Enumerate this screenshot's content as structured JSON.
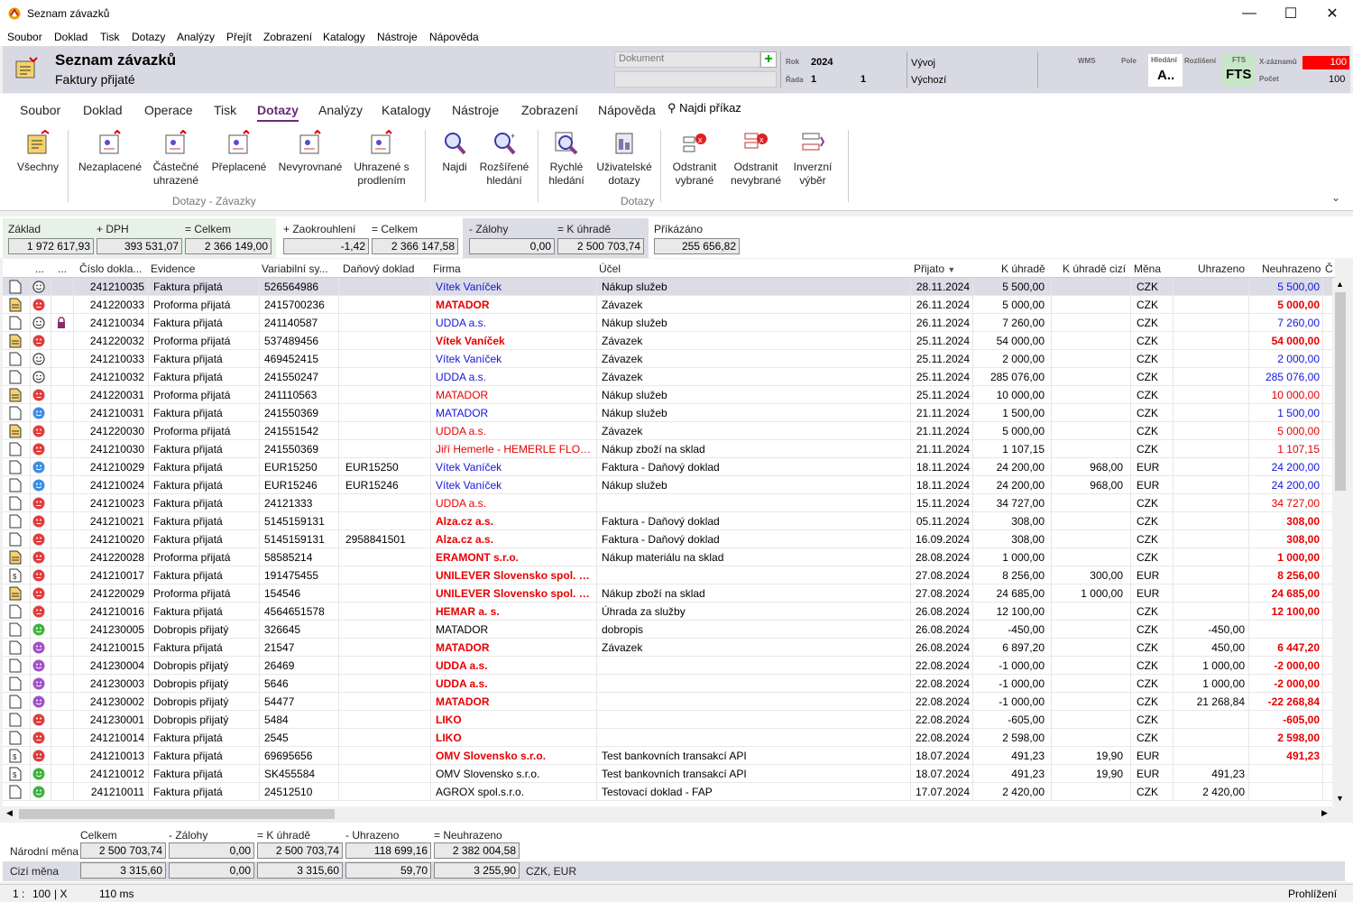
{
  "window": {
    "title": "Seznam závazků"
  },
  "menu": [
    "Soubor",
    "Doklad",
    "Tisk",
    "Dotazy",
    "Analýzy",
    "Přejít",
    "Zobrazení",
    "Katalogy",
    "Nástroje",
    "Nápověda"
  ],
  "header": {
    "title": "Seznam závazků",
    "subtitle": "Faktury přijaté",
    "doc_placeholder": "Dokument",
    "rok_label": "Rok",
    "rok": "2024",
    "rada_label": "Řada",
    "rada1": "1",
    "rada2": "1",
    "vyvoj": "Vývoj",
    "vychozi": "Výchozí",
    "wms": "WMS",
    "pole": "Pole",
    "hledani": "Hledání",
    "hledani_val": "A..",
    "rozliseni": "Rozlišení",
    "fts_label": "FTS",
    "fts": "FTS",
    "xzaz_label": "X-záznamů",
    "xzaz": "100",
    "pocet_label": "Počet",
    "pocet": "100"
  },
  "tabs": [
    "Soubor",
    "Doklad",
    "Operace",
    "Tisk",
    "Dotazy",
    "Analýzy",
    "Katalogy",
    "Nástroje",
    "Zobrazení",
    "Nápověda"
  ],
  "find_cmd": "Najdi příkaz",
  "ribbon": {
    "vsechny": "Všechny",
    "nezaplacene": "Nezaplacené",
    "castecne": [
      "Částečné",
      "uhrazené"
    ],
    "preplacene": "Přeplacené",
    "nevyrovnane": "Nevyrovnané",
    "uhrazene_s": [
      "Uhrazené s",
      "prodlením"
    ],
    "najdi": "Najdi",
    "rozsirene": [
      "Rozšířené",
      "hledání"
    ],
    "rychle": [
      "Rychlé",
      "hledání"
    ],
    "uzivatelske": [
      "Uživatelské",
      "dotazy"
    ],
    "odstranit_vybrane": [
      "Odstranit",
      "vybrané"
    ],
    "odstranit_nevybrane": [
      "Odstranit",
      "nevybrané"
    ],
    "inverzni": [
      "Inverzní",
      "výběr"
    ],
    "group1": "Dotazy - Závazky",
    "group2": "Dotazy"
  },
  "sums": {
    "zaklad_l": "Základ",
    "zaklad": "1 972 617,93",
    "dph_l": "+ DPH",
    "dph": "393 531,07",
    "celkem_l": "= Celkem",
    "celkem": "2 366 149,00",
    "zaokr_l": "+ Zaokrouhlení",
    "zaokr": "-1,42",
    "celkem2_l": "= Celkem",
    "celkem2": "2 366 147,58",
    "zalohy_l": "- Zálohy",
    "zalohy": "0,00",
    "kuhrade_l": "= K úhradě",
    "kuhrade": "2 500 703,74",
    "prikaz_l": "Příkázáno",
    "prikaz": "255 656,82"
  },
  "columns": [
    "...",
    "...",
    "Číslo dokla...",
    "Evidence",
    "Variabilní sy...",
    "Daňový doklad",
    "Firma",
    "Účel",
    "Přijato",
    "K úhradě",
    "K úhradě cizí",
    "Měna",
    "Uhrazeno",
    "Neuhrazeno",
    "Č"
  ],
  "colors": {
    "blue": "#1414dc",
    "red": "#e60000",
    "smile_neutral": "#333333",
    "smile_red": "#e03c3c",
    "smile_blue": "#3c8ce6",
    "smile_green": "#3cb43c",
    "smile_purple": "#a050c8"
  },
  "rows": [
    [
      "doc",
      "neutral",
      "",
      "241210035",
      "Faktura přijatá",
      "526564986",
      "",
      "Vítek Vaníček",
      "blue",
      "Nákup služeb",
      "28.11.2024",
      "5 500,00",
      "",
      "CZK",
      "",
      "5 500,00",
      "blue"
    ],
    [
      "proforma",
      "red",
      "",
      "241220033",
      "Proforma přijatá",
      "2415700236",
      "",
      "MATADOR",
      "redb",
      "Závazek",
      "26.11.2024",
      "5 000,00",
      "",
      "CZK",
      "",
      "5 000,00",
      "redb"
    ],
    [
      "doc",
      "neutral",
      "lock",
      "241210034",
      "Faktura přijatá",
      "241140587",
      "",
      "UDDA a.s.",
      "blue",
      "Nákup služeb",
      "26.11.2024",
      "7 260,00",
      "",
      "CZK",
      "",
      "7 260,00",
      "blue"
    ],
    [
      "proforma",
      "red",
      "",
      "241220032",
      "Proforma přijatá",
      "537489456",
      "",
      "Vítek Vaníček",
      "redb",
      "Závazek",
      "25.11.2024",
      "54 000,00",
      "",
      "CZK",
      "",
      "54 000,00",
      "redb"
    ],
    [
      "doc",
      "neutral",
      "",
      "241210033",
      "Faktura přijatá",
      "469452415",
      "",
      "Vítek Vaníček",
      "blue",
      "Závazek",
      "25.11.2024",
      "2 000,00",
      "",
      "CZK",
      "",
      "2 000,00",
      "blue"
    ],
    [
      "doc",
      "neutral",
      "",
      "241210032",
      "Faktura přijatá",
      "241550247",
      "",
      "UDDA a.s.",
      "blue",
      "Závazek",
      "25.11.2024",
      "285 076,00",
      "",
      "CZK",
      "",
      "285 076,00",
      "blue"
    ],
    [
      "proforma",
      "red",
      "",
      "241220031",
      "Proforma přijatá",
      "241110563",
      "",
      "MATADOR",
      "red",
      "Nákup služeb",
      "25.11.2024",
      "10 000,00",
      "",
      "CZK",
      "",
      "10 000,00",
      "red"
    ],
    [
      "doc",
      "blue",
      "",
      "241210031",
      "Faktura přijatá",
      "241550369",
      "",
      "MATADOR",
      "blue",
      "Nákup služeb",
      "21.11.2024",
      "1 500,00",
      "",
      "CZK",
      "",
      "1 500,00",
      "blue"
    ],
    [
      "proforma",
      "red",
      "",
      "241220030",
      "Proforma přijatá",
      "241551542",
      "",
      "UDDA a.s.",
      "red",
      "Závazek",
      "21.11.2024",
      "5 000,00",
      "",
      "CZK",
      "",
      "5 000,00",
      "red"
    ],
    [
      "doc",
      "red",
      "",
      "241210030",
      "Faktura přijatá",
      "241550369",
      "",
      "Jiří Hemerle - HEMERLE FLOW...",
      "red",
      "Nákup zboží na sklad",
      "21.11.2024",
      "1 107,15",
      "",
      "CZK",
      "",
      "1 107,15",
      "red"
    ],
    [
      "doc",
      "blue",
      "",
      "241210029",
      "Faktura přijatá",
      "EUR15250",
      "EUR15250",
      "Vítek Vaníček",
      "blue",
      "Faktura - Daňový doklad",
      "18.11.2024",
      "24 200,00",
      "968,00",
      "EUR",
      "",
      "24 200,00",
      "blue"
    ],
    [
      "doc",
      "blue",
      "",
      "241210024",
      "Faktura přijatá",
      "EUR15246",
      "EUR15246",
      "Vítek Vaníček",
      "blue",
      "Nákup služeb",
      "18.11.2024",
      "24 200,00",
      "968,00",
      "EUR",
      "",
      "24 200,00",
      "blue"
    ],
    [
      "doc",
      "red",
      "",
      "241210023",
      "Faktura přijatá",
      "24121333",
      "",
      "UDDA a.s.",
      "red",
      "",
      "15.11.2024",
      "34 727,00",
      "",
      "CZK",
      "",
      "34 727,00",
      "red"
    ],
    [
      "doc",
      "red",
      "",
      "241210021",
      "Faktura přijatá",
      "5145159131",
      "",
      "Alza.cz a.s.",
      "redb",
      "Faktura - Daňový doklad",
      "05.11.2024",
      "308,00",
      "",
      "CZK",
      "",
      "308,00",
      "redb"
    ],
    [
      "doc",
      "red",
      "",
      "241210020",
      "Faktura přijatá",
      "5145159131",
      "2958841501",
      "Alza.cz a.s.",
      "redb",
      "Faktura - Daňový doklad",
      "16.09.2024",
      "308,00",
      "",
      "CZK",
      "",
      "308,00",
      "redb"
    ],
    [
      "proforma",
      "red",
      "",
      "241220028",
      "Proforma přijatá",
      "58585214",
      "",
      "ERAMONT s.r.o.",
      "redb",
      "Nákup materiálu na sklad",
      "28.08.2024",
      "1 000,00",
      "",
      "CZK",
      "",
      "1 000,00",
      "redb"
    ],
    [
      "dollar",
      "red",
      "",
      "241210017",
      "Faktura přijatá",
      "191475455",
      "",
      "UNILEVER Slovensko spol. s.r...",
      "redb",
      "",
      "27.08.2024",
      "8 256,00",
      "300,00",
      "EUR",
      "",
      "8 256,00",
      "redb"
    ],
    [
      "proforma",
      "red",
      "",
      "241220029",
      "Proforma přijatá",
      "154546",
      "",
      "UNILEVER Slovensko spol. s.r...",
      "redb",
      "Nákup zboží na sklad",
      "27.08.2024",
      "24 685,00",
      "1 000,00",
      "EUR",
      "",
      "24 685,00",
      "redb"
    ],
    [
      "doc",
      "red",
      "",
      "241210016",
      "Faktura přijatá",
      "4564651578",
      "",
      "HEMAR a. s.",
      "redb",
      "Úhrada za služby",
      "26.08.2024",
      "12 100,00",
      "",
      "CZK",
      "",
      "12 100,00",
      "redb"
    ],
    [
      "doc",
      "green",
      "",
      "241230005",
      "Dobropis přijatý",
      "326645",
      "",
      "MATADOR",
      "plain",
      "dobropis",
      "26.08.2024",
      "-450,00",
      "",
      "CZK",
      "-450,00",
      "",
      ""
    ],
    [
      "doc",
      "purple",
      "",
      "241210015",
      "Faktura přijatá",
      "21547",
      "",
      "MATADOR",
      "redb",
      "Závazek",
      "26.08.2024",
      "6 897,20",
      "",
      "CZK",
      "450,00",
      "6 447,20",
      "redb"
    ],
    [
      "doc",
      "purple",
      "",
      "241230004",
      "Dobropis přijatý",
      "26469",
      "",
      "UDDA a.s.",
      "redb",
      "",
      "22.08.2024",
      "-1 000,00",
      "",
      "CZK",
      "1 000,00",
      "-2 000,00",
      "redb"
    ],
    [
      "doc",
      "purple",
      "",
      "241230003",
      "Dobropis přijatý",
      "5646",
      "",
      "UDDA a.s.",
      "redb",
      "",
      "22.08.2024",
      "-1 000,00",
      "",
      "CZK",
      "1 000,00",
      "-2 000,00",
      "redb"
    ],
    [
      "doc",
      "purple",
      "",
      "241230002",
      "Dobropis přijatý",
      "54477",
      "",
      "MATADOR",
      "redb",
      "",
      "22.08.2024",
      "-1 000,00",
      "",
      "CZK",
      "21 268,84",
      "-22 268,84",
      "redb"
    ],
    [
      "doc",
      "red",
      "",
      "241230001",
      "Dobropis přijatý",
      "5484",
      "",
      "LIKO",
      "redb",
      "",
      "22.08.2024",
      "-605,00",
      "",
      "CZK",
      "",
      "-605,00",
      "redb"
    ],
    [
      "doc",
      "red",
      "",
      "241210014",
      "Faktura přijatá",
      "2545",
      "",
      "LIKO",
      "redb",
      "",
      "22.08.2024",
      "2 598,00",
      "",
      "CZK",
      "",
      "2 598,00",
      "redb"
    ],
    [
      "dollar",
      "red",
      "",
      "241210013",
      "Faktura přijatá",
      "69695656",
      "",
      "OMV Slovensko s.r.o.",
      "redb",
      "Test bankovních transakcí API",
      "18.07.2024",
      "491,23",
      "19,90",
      "EUR",
      "",
      "491,23",
      "redb"
    ],
    [
      "dollar",
      "green",
      "",
      "241210012",
      "Faktura přijatá",
      "SK455584",
      "",
      "OMV Slovensko s.r.o.",
      "plain",
      "Test bankovních transakcí API",
      "18.07.2024",
      "491,23",
      "19,90",
      "EUR",
      "491,23",
      "",
      ""
    ],
    [
      "doc",
      "green",
      "",
      "241210011",
      "Faktura přijatá",
      "24512510",
      "",
      "AGROX spol.s.r.o.",
      "plain",
      "Testovací doklad - FAP",
      "17.07.2024",
      "2 420,00",
      "",
      "CZK",
      "2 420,00",
      "",
      ""
    ]
  ],
  "footer": {
    "celkem": "Celkem",
    "zalohy": "- Zálohy",
    "kuhrade": "= K úhradě",
    "uhrazeno": "- Uhrazeno",
    "neuhrazeno": "= Neuhrazeno",
    "narodni": "Národní měna",
    "cizi": "Cizí měna",
    "n_celkem": "2 500 703,74",
    "n_zalohy": "0,00",
    "n_kuhrade": "2 500 703,74",
    "n_uhrazeno": "118 699,16",
    "n_neuhrazeno": "2 382 004,58",
    "c_celkem": "3 315,60",
    "c_zalohy": "0,00",
    "c_kuhrade": "3 315,60",
    "c_uhrazeno": "59,70",
    "c_neuhrazeno": "3 255,90",
    "c_meny": "CZK, EUR"
  },
  "status": {
    "pos": "1 :",
    "count": "100",
    "x": "| X",
    "time": "110 ms",
    "mode": "Prohlížení"
  }
}
